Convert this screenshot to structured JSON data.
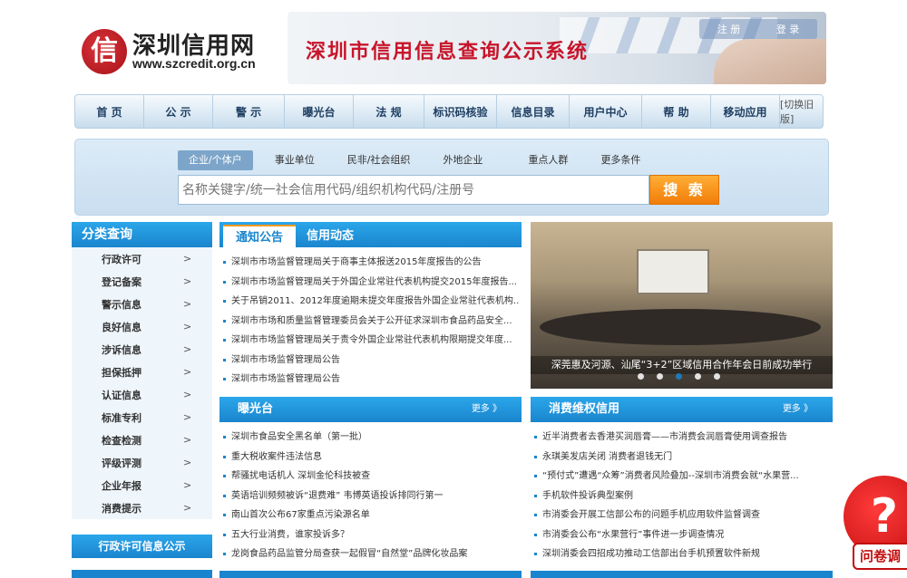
{
  "header": {
    "logo_char": "信",
    "site_name": "深圳信用网",
    "site_url": "www.szcredit.org.cn",
    "banner_title": "深圳市信用信息查询公示系统",
    "register": "注 册",
    "login": "登 录"
  },
  "nav": {
    "items": [
      "首 页",
      "公 示",
      "警 示",
      "曝光台",
      "法 规",
      "标识码核验",
      "信息目录",
      "用户中心",
      "帮 助",
      "移动应用"
    ],
    "switch_old": "[切换旧版]"
  },
  "search": {
    "tabs": [
      "企业/个体户",
      "事业单位",
      "民非/社会组织",
      "外地企业",
      "重点人群",
      "更多条件"
    ],
    "active_tab": 0,
    "placeholder": "名称关键字/统一社会信用代码/组织机构代码/注册号",
    "button": "搜 索"
  },
  "categories": {
    "title": "分类查询",
    "items": [
      "行政许可",
      "登记备案",
      "警示信息",
      "良好信息",
      "涉诉信息",
      "担保抵押",
      "认证信息",
      "标准专利",
      "检查检测",
      "评级评测",
      "企业年报",
      "消费提示"
    ],
    "arrow": ">",
    "button1": "行政许可信息公示"
  },
  "notice": {
    "tab_notice": "通知公告",
    "tab_news": "信用动态",
    "items": [
      "深圳市市场监督管理局关于商事主体报送2015年度报告的公告",
      "深圳市市场监督管理局关于外国企业常驻代表机构提交2015年度报告...",
      "关于吊销2011、2012年度逾期未提交年度报告外国企业常驻代表机构...",
      "深圳市市场和质量监督管理委员会关于公开征求深圳市食品药品安全...",
      "深圳市市场监督管理局关于责令外国企业常驻代表机构限期提交年度...",
      "深圳市市场监督管理局公告",
      "深圳市市场监督管理局公告"
    ]
  },
  "slide": {
    "caption": "深莞惠及河源、汕尾“3+2”区域信用合作年会日前成功举行",
    "dot_count": 5,
    "active_dot": 2
  },
  "exposure": {
    "title": "曝光台",
    "more": "更多 》",
    "items": [
      "深圳市食品安全黑名单（第一批）",
      "重大税收案件违法信息",
      "帮骚扰电话机人 深圳金伦科技被查",
      "英语培训频频被诉“退费难” 韦博英语投诉排同行第一",
      "南山首次公布67家重点污染源名单",
      "五大行业消费，谁家投诉多？",
      "龙岗食品药品监管分局查获一起假冒“自然堂”品牌化妆品案"
    ]
  },
  "consumer": {
    "title": "消费维权信用",
    "more": "更多 》",
    "items": [
      "近半消费者去香港买润唇膏——市消费会润唇膏使用调查报告",
      "永琪美发店关闭 消费者退钱无门",
      "“预付式”遭遇“众筹”消费者风险叠加--深圳市消费会就“水果营...",
      "手机软件投诉典型案例",
      "市消委会开展工信部公布的问题手机应用软件监督调查",
      "市消委会公布“水果营行”事件进一步调查情况",
      "深圳消委会四招成功推动工信部出台手机预置软件新规"
    ]
  },
  "float": {
    "symbol": "?",
    "label": "问卷调"
  }
}
